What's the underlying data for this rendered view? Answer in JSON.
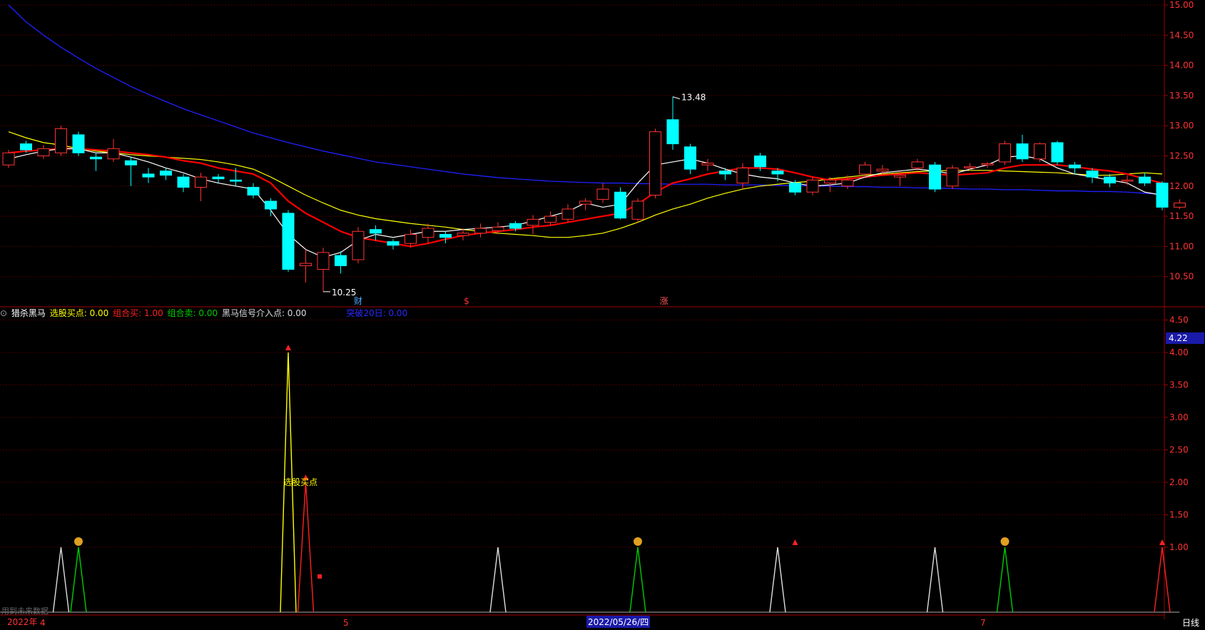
{
  "legend": {
    "indicator_name": "猎杀黑马",
    "items": [
      {
        "label": "选股买点: 0.00",
        "color": "#ffff00"
      },
      {
        "label": "组合买: 1.00",
        "color": "#ff2020"
      },
      {
        "label": "组合卖: 0.00",
        "color": "#00cc00"
      },
      {
        "label": "黑马信号介入点: 0.00",
        "color": "#dddddd"
      },
      {
        "label": "突破20日: 0.00",
        "color": "#2a2aff"
      }
    ]
  },
  "status_text": "用到未来数据",
  "period_label": "日线",
  "x_axis": {
    "labels": [
      "2022年",
      "4",
      "5",
      "2022/05/26/四",
      "7"
    ]
  },
  "chart_data": [
    {
      "type": "candlestick",
      "ylim": [
        10.0,
        15.0
      ],
      "yticks": [
        "10.50",
        "11.00",
        "11.50",
        "12.00",
        "12.50",
        "13.00",
        "13.50",
        "14.00",
        "14.50",
        "15.00"
      ],
      "annotations": {
        "high": "13.48",
        "low": "10.25",
        "markers": [
          "财",
          "$",
          "涨"
        ]
      },
      "colors": {
        "up": "#ff3333",
        "down": "#00ffff",
        "ma5": "#ffffff",
        "ma10": "#ff0000",
        "ma20": "#ffff00",
        "ma60": "#2020ff"
      },
      "candles": [
        [
          12.35,
          12.55,
          12.6,
          12.3
        ],
        [
          12.7,
          12.6,
          12.75,
          12.55
        ],
        [
          12.5,
          12.62,
          12.68,
          12.45
        ],
        [
          12.55,
          12.95,
          13.0,
          12.5
        ],
        [
          12.85,
          12.55,
          12.9,
          12.5
        ],
        [
          12.48,
          12.45,
          12.55,
          12.25
        ],
        [
          12.45,
          12.62,
          12.78,
          12.4
        ],
        [
          12.42,
          12.35,
          12.48,
          12.0
        ],
        [
          12.2,
          12.15,
          12.3,
          12.05
        ],
        [
          12.25,
          12.18,
          12.3,
          12.1
        ],
        [
          12.15,
          11.98,
          12.2,
          11.9
        ],
        [
          11.98,
          12.15,
          12.22,
          11.75
        ],
        [
          12.15,
          12.12,
          12.2,
          12.05
        ],
        [
          12.1,
          12.08,
          12.3,
          12.0
        ],
        [
          11.98,
          11.85,
          12.05,
          11.8
        ],
        [
          11.75,
          11.62,
          11.8,
          11.5
        ],
        [
          11.55,
          10.62,
          11.6,
          10.58
        ],
        [
          10.68,
          10.72,
          10.95,
          10.4
        ],
        [
          10.62,
          10.9,
          10.98,
          10.25
        ],
        [
          10.85,
          10.68,
          10.92,
          10.55
        ],
        [
          10.78,
          11.25,
          11.32,
          10.72
        ],
        [
          11.28,
          11.22,
          11.35,
          11.1
        ],
        [
          11.08,
          11.02,
          11.12,
          10.95
        ],
        [
          11.05,
          11.2,
          11.28,
          10.98
        ],
        [
          11.15,
          11.3,
          11.38,
          11.05
        ],
        [
          11.2,
          11.15,
          11.25,
          11.05
        ],
        [
          11.18,
          11.22,
          11.3,
          11.1
        ],
        [
          11.22,
          11.3,
          11.38,
          11.15
        ],
        [
          11.26,
          11.32,
          11.4,
          11.2
        ],
        [
          11.38,
          11.3,
          11.42,
          11.25
        ],
        [
          11.35,
          11.45,
          11.52,
          11.2
        ],
        [
          11.4,
          11.5,
          11.58,
          11.35
        ],
        [
          11.45,
          11.62,
          11.7,
          11.4
        ],
        [
          11.7,
          11.75,
          11.8,
          11.6
        ],
        [
          11.78,
          11.95,
          12.05,
          11.72
        ],
        [
          11.9,
          11.47,
          11.98,
          11.45
        ],
        [
          11.45,
          11.75,
          11.8,
          11.4
        ],
        [
          11.85,
          12.9,
          12.95,
          11.8
        ],
        [
          13.1,
          12.7,
          13.48,
          12.6
        ],
        [
          12.65,
          12.28,
          12.7,
          12.2
        ],
        [
          12.35,
          12.38,
          12.45,
          12.25
        ],
        [
          12.25,
          12.2,
          12.3,
          12.1
        ],
        [
          12.05,
          12.3,
          12.38,
          11.95
        ],
        [
          12.5,
          12.32,
          12.55,
          12.25
        ],
        [
          12.25,
          12.2,
          12.3,
          12.08
        ],
        [
          12.05,
          11.9,
          12.1,
          11.85
        ],
        [
          11.9,
          12.1,
          12.15,
          11.85
        ],
        [
          12.05,
          12.1,
          12.15,
          11.9
        ],
        [
          12.0,
          12.1,
          12.18,
          11.95
        ],
        [
          12.2,
          12.35,
          12.4,
          12.15
        ],
        [
          12.25,
          12.28,
          12.35,
          12.18
        ],
        [
          12.15,
          12.18,
          12.25,
          12.0
        ],
        [
          12.3,
          12.4,
          12.45,
          12.25
        ],
        [
          12.35,
          11.95,
          12.4,
          11.9
        ],
        [
          12.0,
          12.3,
          12.35,
          11.95
        ],
        [
          12.3,
          12.32,
          12.38,
          12.25
        ],
        [
          12.35,
          12.37,
          12.4,
          12.3
        ],
        [
          12.4,
          12.7,
          12.75,
          12.35
        ],
        [
          12.7,
          12.45,
          12.85,
          12.4
        ],
        [
          12.45,
          12.7,
          12.72,
          12.4
        ],
        [
          12.72,
          12.4,
          12.75,
          12.35
        ],
        [
          12.35,
          12.3,
          12.4,
          12.2
        ],
        [
          12.25,
          12.15,
          12.3,
          12.05
        ],
        [
          12.15,
          12.05,
          12.2,
          11.98
        ],
        [
          12.08,
          12.1,
          12.18,
          12.02
        ],
        [
          12.15,
          12.05,
          12.22,
          12.0
        ],
        [
          12.05,
          11.65,
          12.08,
          11.6
        ],
        [
          11.65,
          11.72,
          11.78,
          11.62
        ]
      ],
      "ma5": [
        12.45,
        12.52,
        12.58,
        12.62,
        12.62,
        12.55,
        12.55,
        12.48,
        12.4,
        12.3,
        12.22,
        12.12,
        12.05,
        12.0,
        11.95,
        11.6,
        11.2,
        10.95,
        10.82,
        10.9,
        11.1,
        11.2,
        11.15,
        11.2,
        11.25,
        11.25,
        11.28,
        11.3,
        11.32,
        11.35,
        11.42,
        11.5,
        11.58,
        11.72,
        11.65,
        11.7,
        12.05,
        12.35,
        12.4,
        12.45,
        12.38,
        12.28,
        12.2,
        12.15,
        12.12,
        12.05,
        12.0,
        12.02,
        12.05,
        12.15,
        12.22,
        12.25,
        12.28,
        12.25,
        12.2,
        12.28,
        12.35,
        12.48,
        12.5,
        12.45,
        12.3,
        12.2,
        12.15,
        12.1,
        12.05,
        11.9,
        11.85
      ],
      "ma10": [
        12.55,
        12.58,
        12.6,
        12.62,
        12.62,
        12.6,
        12.58,
        12.55,
        12.52,
        12.48,
        12.42,
        12.38,
        12.3,
        12.25,
        12.2,
        12.05,
        11.75,
        11.55,
        11.4,
        11.25,
        11.15,
        11.1,
        11.05,
        11.0,
        11.05,
        11.12,
        11.18,
        11.22,
        11.25,
        11.28,
        11.32,
        11.35,
        11.4,
        11.45,
        11.5,
        11.55,
        11.7,
        11.9,
        12.05,
        12.12,
        12.2,
        12.25,
        12.3,
        12.3,
        12.28,
        12.22,
        12.15,
        12.1,
        12.12,
        12.15,
        12.18,
        12.2,
        12.22,
        12.2,
        12.18,
        12.2,
        12.22,
        12.3,
        12.35,
        12.35,
        12.35,
        12.32,
        12.28,
        12.25,
        12.2,
        12.12,
        12.05
      ],
      "ma20": [
        12.9,
        12.8,
        12.72,
        12.68,
        12.62,
        12.58,
        12.55,
        12.52,
        12.5,
        12.48,
        12.46,
        12.44,
        12.4,
        12.35,
        12.28,
        12.15,
        12.0,
        11.85,
        11.72,
        11.6,
        11.52,
        11.46,
        11.42,
        11.38,
        11.35,
        11.32,
        11.28,
        11.25,
        11.22,
        11.2,
        11.18,
        11.15,
        11.15,
        11.18,
        11.22,
        11.3,
        11.4,
        11.52,
        11.62,
        11.7,
        11.8,
        11.88,
        11.95,
        12.0,
        12.03,
        12.06,
        12.08,
        12.12,
        12.15,
        12.18,
        12.2,
        12.22,
        12.24,
        12.25,
        12.26,
        12.26,
        12.26,
        12.25,
        12.24,
        12.23,
        12.22,
        12.2,
        12.18,
        12.18,
        12.2,
        12.22,
        12.2
      ],
      "ma60": [
        15.0,
        14.72,
        14.5,
        14.3,
        14.12,
        13.95,
        13.8,
        13.65,
        13.52,
        13.4,
        13.28,
        13.18,
        13.08,
        12.98,
        12.88,
        12.8,
        12.72,
        12.65,
        12.58,
        12.52,
        12.46,
        12.4,
        12.36,
        12.32,
        12.28,
        12.24,
        12.2,
        12.17,
        12.14,
        12.12,
        12.1,
        12.08,
        12.07,
        12.06,
        12.05,
        12.05,
        12.04,
        12.04,
        12.03,
        12.03,
        12.03,
        12.02,
        12.02,
        12.02,
        12.01,
        12.01,
        12.0,
        12.0,
        11.99,
        11.99,
        11.98,
        11.98,
        11.97,
        11.97,
        11.96,
        11.95,
        11.95,
        11.94,
        11.94,
        11.93,
        11.92,
        11.92,
        11.91,
        11.91,
        11.9,
        11.88,
        11.86
      ]
    },
    {
      "type": "line",
      "title": "猎杀黑马",
      "ylim": [
        0,
        4.5
      ],
      "yticks": [
        "1.00",
        "1.50",
        "2.00",
        "2.50",
        "3.00",
        "3.50",
        "4.00",
        "4.50"
      ],
      "current_value": "4.22",
      "label": "选股买点",
      "series": [
        {
          "name": "选股买点",
          "color": "#ffff00",
          "peaks": [
            [
              16,
              4.0
            ]
          ]
        },
        {
          "name": "组合买",
          "color": "#ff2020",
          "peaks": [
            [
              17,
              2.0
            ],
            [
              66,
              1.0
            ]
          ]
        },
        {
          "name": "组合卖",
          "color": "#00cc00",
          "peaks": [
            [
              4,
              1.0
            ],
            [
              36,
              1.0
            ],
            [
              57,
              1.0
            ]
          ]
        },
        {
          "name": "黑马信号介入点",
          "color": "#dddddd",
          "peaks": [
            [
              3,
              1.0
            ],
            [
              28,
              1.0
            ],
            [
              44,
              1.0
            ],
            [
              53,
              1.0
            ]
          ]
        }
      ]
    }
  ]
}
